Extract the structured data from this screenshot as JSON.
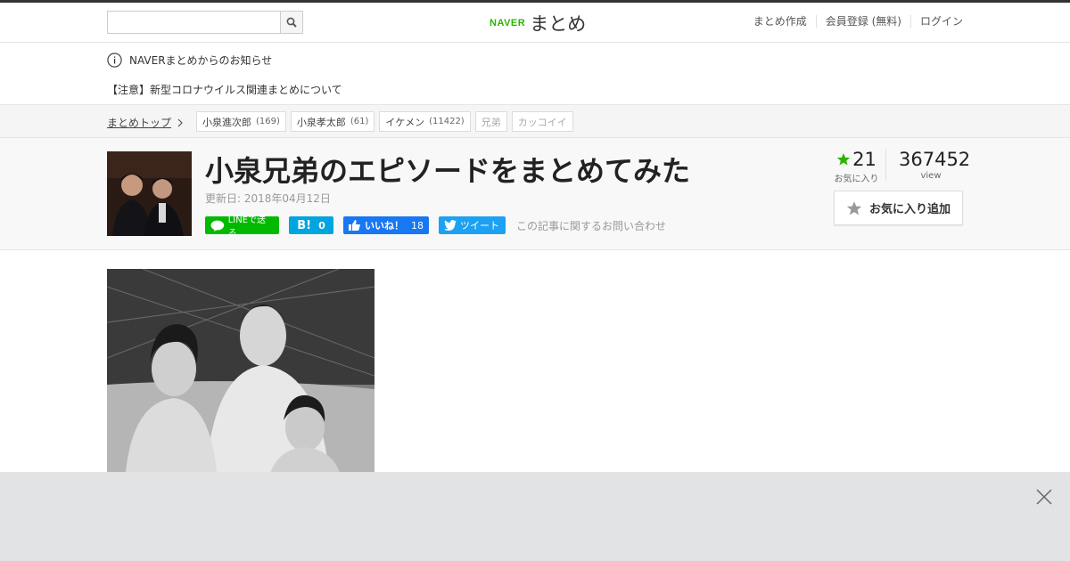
{
  "header": {
    "search": {
      "placeholder": ""
    },
    "logo": {
      "brand": "NAVER",
      "name": "まとめ"
    },
    "nav": [
      "まとめ作成",
      "会員登録 (無料)",
      "ログイン"
    ]
  },
  "notice": {
    "heading": "NAVERまとめからのお知らせ",
    "link": "【注意】新型コロナウイルス関連まとめについて"
  },
  "tagbar": {
    "breadcrumb": "まとめトップ",
    "tags": [
      {
        "name": "小泉進次郎",
        "count": "(169)"
      },
      {
        "name": "小泉孝太郎",
        "count": "(61)"
      },
      {
        "name": "イケメン",
        "count": "(11422)"
      },
      {
        "name": "兄弟",
        "count": ""
      },
      {
        "name": "カッコイイ",
        "count": ""
      }
    ]
  },
  "article": {
    "title": "小泉兄弟のエピソードをまとめてみた",
    "updated": "更新日: 2018年04月12日",
    "share": {
      "line": "LINEで送る",
      "hatena_mark": "B!",
      "hatena_count": "0",
      "fb_label": "いいね！",
      "fb_count": "18",
      "tweet": "ツイート"
    },
    "contact": "この記事に関するお問い合わせ",
    "favorites": {
      "count": "21",
      "label": "お気に入り"
    },
    "views": {
      "count": "367452",
      "label": "view"
    },
    "fav_button": "お気に入り追加"
  },
  "colors": {
    "brand_green": "#2db400",
    "line_green": "#00b900",
    "hatena_blue": "#00a4de",
    "facebook_blue": "#1877f2",
    "twitter_blue": "#1da1f2"
  }
}
